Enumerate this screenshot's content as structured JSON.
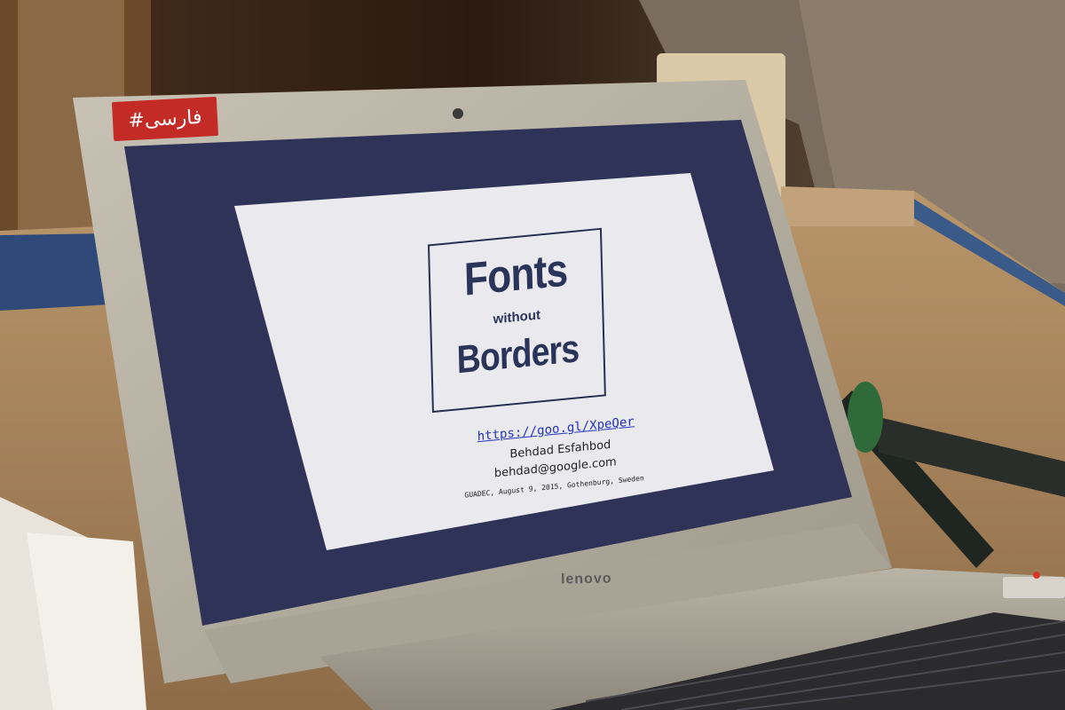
{
  "sticker": {
    "text": "#فارسی",
    "color": "#c42b26"
  },
  "laptop": {
    "brand": "lenovo"
  },
  "slide": {
    "title_line1": "Fonts",
    "title_line2": "without",
    "title_line3": "Borders",
    "link": "https://goo.gl/XpeQer",
    "author": "Behdad Esfahbod",
    "email": "behdad@google.com",
    "event": "GUADEC, August 9, 2015, Gothenburg, Sweden"
  },
  "colors": {
    "screen_bezel": "#2f3358",
    "slide_bg": "#e9e9ee",
    "title_text": "#2a3358",
    "link": "#2233bb",
    "laptop_frame": "#b8b2a4"
  }
}
